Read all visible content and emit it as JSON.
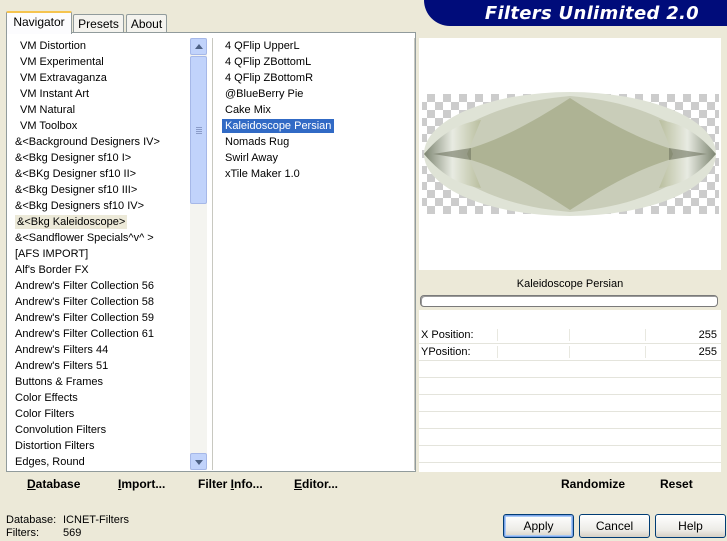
{
  "tabs": [
    "Navigator",
    "Presets",
    "About"
  ],
  "banner": {
    "title": "Filters Unlimited 2.0"
  },
  "categories": [
    "VM Distortion",
    "VM Experimental",
    "VM Extravaganza",
    "VM Instant Art",
    "VM Natural",
    "VM Toolbox",
    "&<Background Designers IV>",
    "&<Bkg Designer sf10 I>",
    "&<BKg Designer sf10 II>",
    "&<Bkg Designer sf10 III>",
    "&<Bkg Designers sf10 IV>",
    "&<Bkg Kaleidoscope>",
    "&<Sandflower Specials^v^ >",
    "[AFS IMPORT]",
    "Alf's Border FX",
    "Andrew's Filter Collection 56",
    "Andrew's Filter Collection 58",
    "Andrew's Filter Collection 59",
    "Andrew's Filter Collection 61",
    "Andrew's Filters 44",
    "Andrew's Filters 51",
    "Buttons & Frames",
    "Color Effects",
    "Color Filters",
    "Convolution Filters",
    "Distortion Filters",
    "Edges, Round"
  ],
  "selected_category": "&<Bkg Kaleidoscope>",
  "filters": [
    "4 QFlip UpperL",
    "4 QFlip ZBottomL",
    "4 QFlip ZBottomR",
    "@BlueBerry Pie",
    "Cake Mix",
    "Kaleidoscope Persian",
    "Nomads Rug",
    "Swirl Away",
    "xTile Maker 1.0"
  ],
  "selected_filter": "Kaleidoscope Persian",
  "preview": {
    "filter_name": "Kaleidoscope Persian",
    "colors": {
      "sage": "#aeb394",
      "light": "#dfe3d6",
      "dark": "#6f7560"
    }
  },
  "params": [
    {
      "label": "X Position:",
      "value": "255"
    },
    {
      "label": "YPosition:",
      "value": "255"
    }
  ],
  "left_buttons": [
    {
      "text": "Database",
      "underline": "D"
    },
    {
      "text": "Import...",
      "underline": "I"
    },
    {
      "text": "Filter Info...",
      "underline": "I"
    },
    {
      "text": "Editor...",
      "underline": "E"
    }
  ],
  "right_buttons": {
    "randomize": "Randomize",
    "reset": "Reset"
  },
  "status": {
    "database_label": "Database:",
    "database_value": "ICNET-Filters",
    "filters_label": "Filters:",
    "filters_value": "569"
  },
  "dialog_buttons": {
    "apply": "Apply",
    "cancel": "Cancel",
    "help": "Help"
  },
  "colors": {
    "selection": "#316ac5",
    "banner": "#000c7a",
    "dialog": "#ece9d8"
  }
}
